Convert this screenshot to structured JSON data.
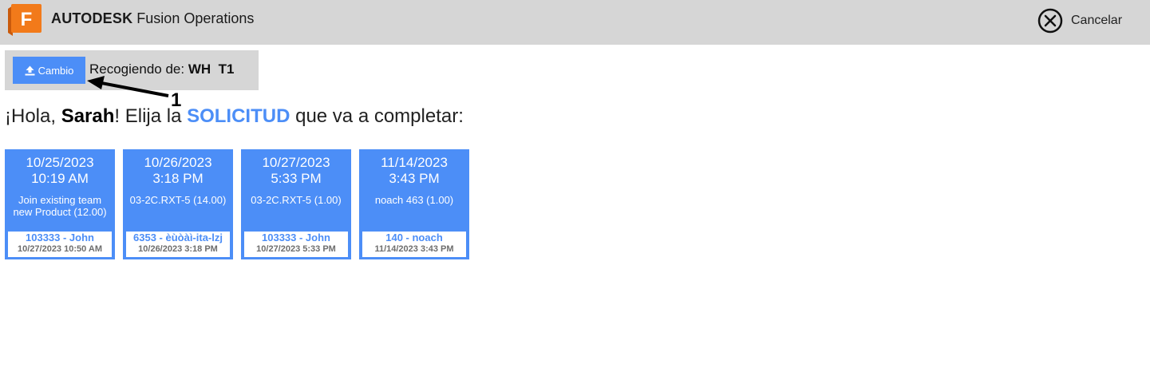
{
  "header": {
    "logo_letter": "F",
    "brand_bold": "AUTODESK",
    "brand_product": "Fusion Operations",
    "cancel_label": "Cancelar",
    "cancel_icon": "close-circle-icon"
  },
  "source": {
    "button_label": "Cambio",
    "button_icon": "upload-icon",
    "prefix": "Recogiendo de:",
    "location": "WH  T1"
  },
  "annotation": {
    "number": "1"
  },
  "greeting": {
    "hello": "¡Hola, ",
    "name": "Sarah",
    "middle": "! Elija la ",
    "keyword": "SOLICITUD",
    "suffix": " que va a completar:"
  },
  "requests": [
    {
      "date": "10/25/2023",
      "time": "10:19 AM",
      "product": "Join existing team new Product (12.00)",
      "who": "103333 - John",
      "when": "10/27/2023 10:50 AM"
    },
    {
      "date": "10/26/2023",
      "time": "3:18 PM",
      "product": "03-2C.RXT-5 (14.00)",
      "who": "6353 - èùòàì-ita-lzj",
      "when": "10/26/2023 3:18 PM"
    },
    {
      "date": "10/27/2023",
      "time": "5:33 PM",
      "product": "03-2C.RXT-5 (1.00)",
      "who": "103333 - John",
      "when": "10/27/2023 5:33 PM"
    },
    {
      "date": "11/14/2023",
      "time": "3:43 PM",
      "product": "noach 463 (1.00)",
      "who": "140 - noach",
      "when": "11/14/2023 3:43 PM"
    }
  ],
  "colors": {
    "accent": "#4c8ef7",
    "header_bg": "#d6d6d6",
    "logo_orange": "#f27a1a"
  }
}
